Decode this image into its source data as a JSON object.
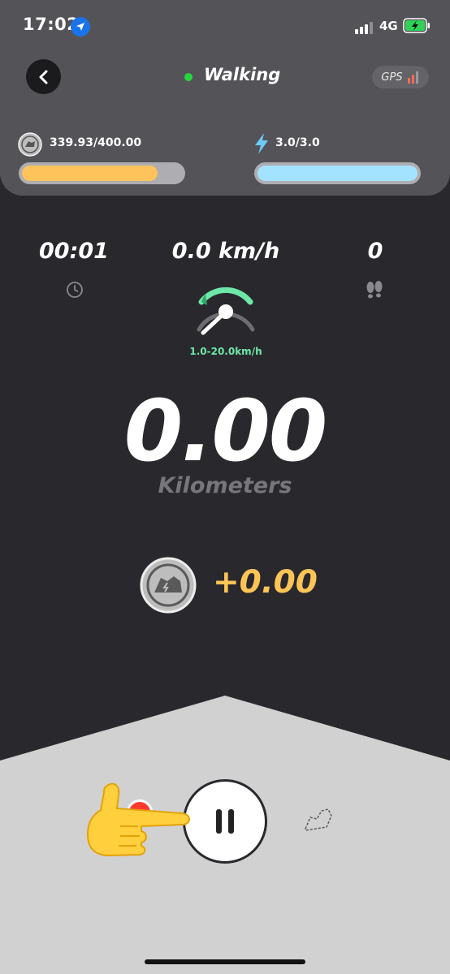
{
  "status_bar": {
    "time": "17:02",
    "network": "4G",
    "location_icon": "location-arrow-icon",
    "battery_icon": "battery-charging-icon"
  },
  "header": {
    "back_icon": "chevron-left-icon",
    "mode_label": "Walking",
    "mode_status_color": "#28d63c",
    "gps_label": "GPS",
    "gps_signal_icon": "signal-bars-icon"
  },
  "resources": {
    "token_text": "339.93/400.00",
    "token_fraction": 0.85,
    "token_bar_color": "#ffc35b",
    "energy_text": "3.0/3.0",
    "energy_fraction": 1.0,
    "energy_bar_color": "#a4e3ff"
  },
  "stats": {
    "time": "00:01",
    "speed": "0.0 km/h",
    "steps": "0",
    "speed_range": "1.0-20.0km/h"
  },
  "distance": {
    "value": "0.00",
    "unit": "Kilometers"
  },
  "earnings": {
    "value": "+0.00",
    "coin_icon": "shoe-coin-icon"
  },
  "controls": {
    "pause_icon": "pause-icon",
    "pointer_icon": "pointing-hand-icon",
    "shoe_icon": "shoe-outline-icon"
  }
}
